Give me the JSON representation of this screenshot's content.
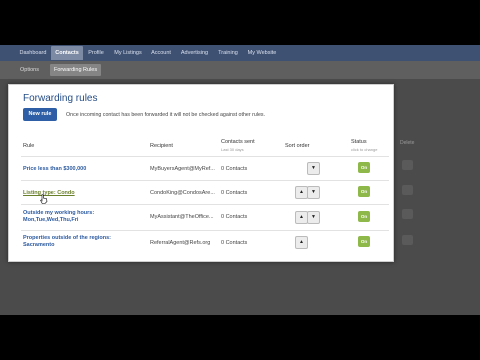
{
  "nav": {
    "tabs": [
      {
        "label": "Dashboard"
      },
      {
        "label": "Contacts",
        "active": true
      },
      {
        "label": "Profile"
      },
      {
        "label": "My Listings"
      },
      {
        "label": "Account"
      },
      {
        "label": "Advertising"
      },
      {
        "label": "Training"
      },
      {
        "label": "My Website"
      }
    ]
  },
  "subnav": {
    "tabs": [
      {
        "label": "Options"
      },
      {
        "label": "Forwarding Rules",
        "active": true
      }
    ]
  },
  "background": {
    "delete_header": "Delete"
  },
  "panel": {
    "title": "Forwarding rules",
    "new_rule_label": "New rule",
    "hint": "Once incoming contact has been forwarded it will not be checked against other rules.",
    "headers": {
      "rule": "Rule",
      "recipient": "Recipient",
      "contacts_sent": "Contacts sent",
      "contacts_sent_sub": "Last 30 days",
      "sort_order": "Sort order",
      "status": "Status",
      "status_sub": "click to change"
    },
    "rows": [
      {
        "rule": "Price less than $300,000",
        "recipient": "MyBuyersAgent@MyRef...",
        "contacts": "0 Contacts",
        "sort": [
          "down"
        ],
        "status": "On"
      },
      {
        "rule": "Listing type: Condo",
        "recipient": "CondoKing@CondosAre...",
        "contacts": "0 Contacts",
        "sort": [
          "up",
          "down"
        ],
        "status": "On"
      },
      {
        "rule": "Outside my working hours: Mon,Tue,Wed,Thu,Fri",
        "recipient": "MyAssistant@TheOffice...",
        "contacts": "0 Contacts",
        "sort": [
          "up",
          "down"
        ],
        "status": "On"
      },
      {
        "rule": "Properties outside of the regions: Sacramento",
        "recipient": "ReferralAgent@Refs.org",
        "contacts": "0 Contacts",
        "sort": [
          "up"
        ],
        "status": "On"
      }
    ]
  },
  "colors": {
    "navbar": "#3f5173",
    "accent": "#2e5fa6",
    "status_on": "#8fb84a"
  }
}
